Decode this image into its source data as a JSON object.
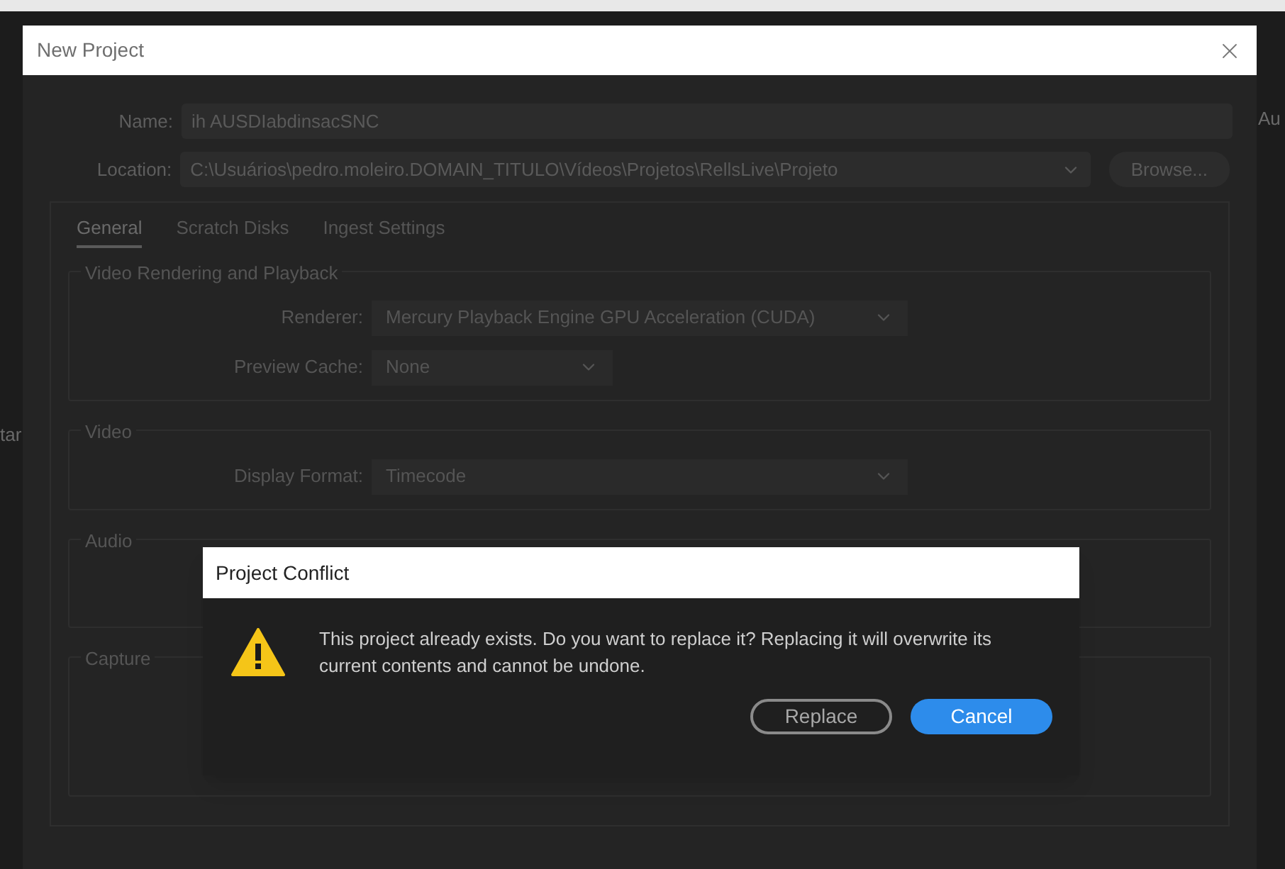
{
  "background": {
    "fragments": [
      {
        "kind": "right",
        "text": "Au"
      },
      {
        "kind": "left",
        "text": "tar"
      }
    ]
  },
  "window": {
    "title": "New Project"
  },
  "form": {
    "name": {
      "label": "Name:",
      "value": "ih AUSDIabdinsacSNC"
    },
    "location": {
      "label": "Location:",
      "value": "C:\\Usuários\\pedro.moleiro.DOMAIN_TITULO\\Vídeos\\Projetos\\RellsLive\\Projeto"
    },
    "browse": "Browse..."
  },
  "tabs": [
    {
      "label": "General",
      "selected": true
    },
    {
      "label": "Scratch Disks",
      "selected": false
    },
    {
      "label": "Ingest Settings",
      "selected": false
    }
  ],
  "sections": [
    {
      "title": "Video Rendering and Playback",
      "fields": [
        {
          "label": "Renderer:",
          "value": "Mercury Playback Engine GPU Acceleration (CUDA)",
          "kind": "wide"
        },
        {
          "label": "Preview Cache:",
          "value": "None",
          "kind": "narrow"
        }
      ]
    },
    {
      "title": "Video",
      "fields": [
        {
          "label": "Display Format:",
          "value": "Timecode",
          "kind": "wide"
        }
      ]
    },
    {
      "title": "Audio"
    },
    {
      "title": "Capture"
    }
  ],
  "conflict_dialog": {
    "title": "Project Conflict",
    "message": "This project already exists. Do you want to replace it? Replacing it will overwrite its current contents and cannot be undone.",
    "buttons": [
      {
        "label": "Replace",
        "kind": "secondary"
      },
      {
        "label": "Cancel",
        "kind": "primary"
      }
    ]
  }
}
